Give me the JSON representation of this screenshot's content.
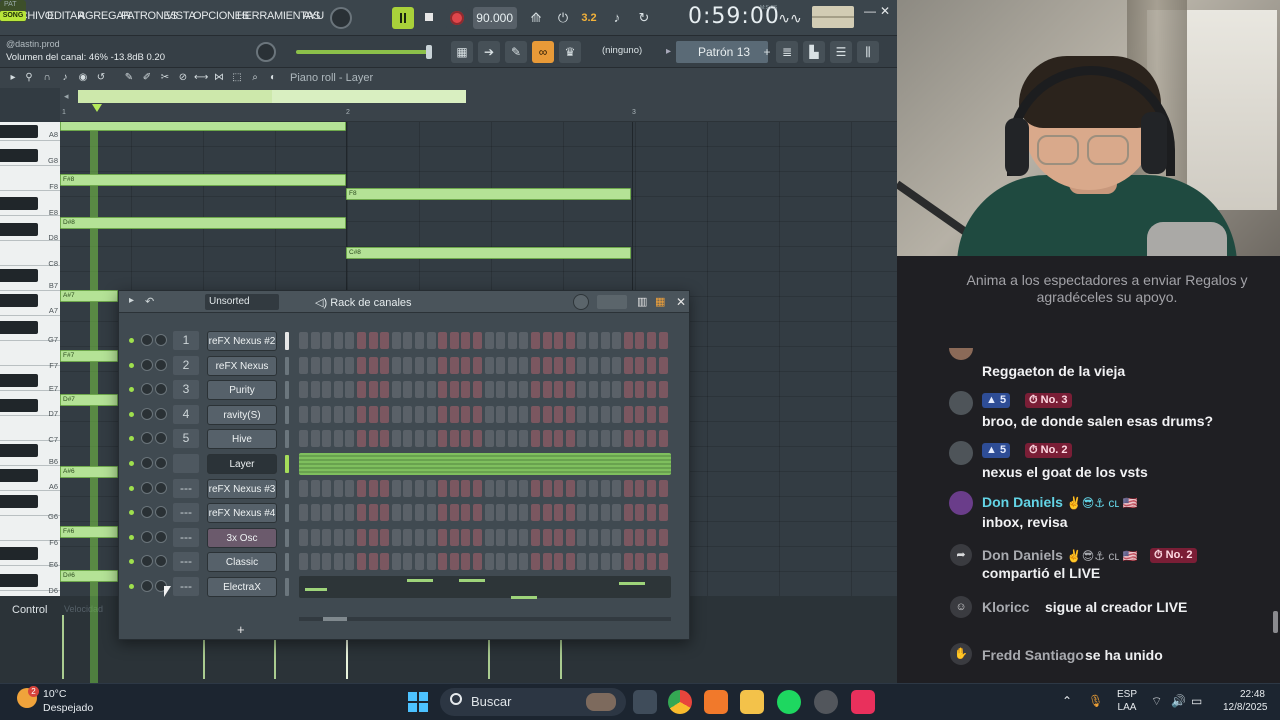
{
  "fl": {
    "menu": [
      "ARCHIVO",
      "EDITAR",
      "AGREGAR",
      "PATRONES",
      "VISTA",
      "OPCIONES",
      "HERRAMIENTAS",
      "AYU"
    ],
    "transport": {
      "pat_label": "PAT",
      "song_label": "SONG",
      "tempo": "90.000",
      "time": "0:59:00",
      "time_unit": "M:S:CS",
      "rec_mode": "3.2"
    },
    "hint": {
      "title": "@dastin.prod",
      "text": "Volumen del canal: 46%  -13.8dB  0.20"
    },
    "toolbar2": {
      "none_label": "(ninguno)",
      "pattern": "Patrón 13",
      "pattern_add": "+"
    },
    "piano_roll": {
      "title": "Piano roll - Layer",
      "ruler": [
        "1",
        "2",
        "3"
      ],
      "keys": [
        "A8",
        "G8",
        "F8",
        "E8",
        "D8",
        "C8",
        "B7",
        "A7",
        "G7",
        "F7",
        "E7",
        "D7",
        "C7",
        "B6",
        "A6",
        "G6",
        "F6",
        "E6",
        "D6"
      ],
      "note_labels": [
        "F#8",
        "D#8",
        "F8",
        "C#8",
        "A#7",
        "F#7",
        "D#7",
        "A#6",
        "F#6",
        "D#6"
      ],
      "control_label": "Control",
      "velocity_label": "Velocidad"
    },
    "rack": {
      "filter": "Unsorted",
      "title": "Rack de canales",
      "add_label": "+",
      "channels": [
        {
          "num": "1",
          "name": "reFX Nexus #2"
        },
        {
          "num": "2",
          "name": "reFX Nexus"
        },
        {
          "num": "3",
          "name": "Purity"
        },
        {
          "num": "4",
          "name": "ravity(S)"
        },
        {
          "num": "5",
          "name": "Hive"
        },
        {
          "num": "",
          "name": "Layer"
        },
        {
          "num": "---",
          "name": "reFX Nexus #3"
        },
        {
          "num": "---",
          "name": "reFX Nexus #4"
        },
        {
          "num": "---",
          "name": "3x Osc"
        },
        {
          "num": "---",
          "name": "Classic"
        },
        {
          "num": "---",
          "name": "ElectraX"
        }
      ]
    }
  },
  "chat": {
    "hint": "Anima a los espectadores a enviar Regalos y agradéceles su apoyo.",
    "messages": [
      {
        "text": "Reggaeton de la vieja"
      },
      {
        "level": "5",
        "rank": "No. 3",
        "text": "broo, de donde salen esas drums?"
      },
      {
        "level": "5",
        "rank": "No. 2",
        "text": "nexus el goat de los vsts"
      },
      {
        "user": "Don Daniels",
        "emoji": "✌️😎⚓ cʟ 🇺🇸",
        "text": "inbox, revisa"
      },
      {
        "user": "Don Daniels",
        "emoji": "✌️😎⚓ cʟ 🇺🇸",
        "rank": "No. 2",
        "text": "compartió el LIVE"
      },
      {
        "user": "Kloricc",
        "text": "sigue al creador LIVE"
      },
      {
        "user": "Fredd Santiago",
        "text": "se ha unido"
      }
    ]
  },
  "taskbar": {
    "weather_temp": "10°C",
    "weather_desc": "Despejado",
    "weather_badge": "2",
    "search": "Buscar",
    "lang_1": "ESP",
    "lang_2": "LAA",
    "time": "22:48",
    "date": "12/8/2025"
  },
  "colors": {
    "fl_bg": "#323b42",
    "note_green": "#b4e296",
    "play_green": "#a9d13a",
    "record_red": "#e0464b",
    "chat_bg": "#1f1f23",
    "taskbar_bg": "#1c2530"
  }
}
